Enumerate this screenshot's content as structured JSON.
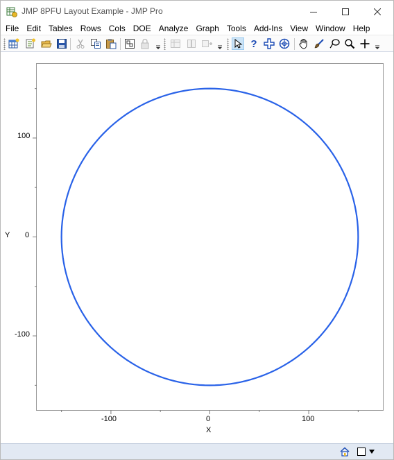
{
  "window": {
    "title": "JMP 8PFU Layout Example - JMP Pro"
  },
  "menu": {
    "items": [
      {
        "label": "File"
      },
      {
        "label": "Edit"
      },
      {
        "label": "Tables"
      },
      {
        "label": "Rows"
      },
      {
        "label": "Cols"
      },
      {
        "label": "DOE"
      },
      {
        "label": "Analyze"
      },
      {
        "label": "Graph"
      },
      {
        "label": "Tools"
      },
      {
        "label": "Add-Ins"
      },
      {
        "label": "View"
      },
      {
        "label": "Window"
      },
      {
        "label": "Help"
      }
    ]
  },
  "toolbar": {
    "icons": [
      "new-data-table-icon",
      "new-script-icon",
      "open-icon",
      "save-icon",
      "cut-icon",
      "copy-icon",
      "paste-icon",
      "report-icon",
      "lock-icon",
      "table-icon",
      "journal-icon",
      "add-icon",
      "arrow-icon",
      "help-icon",
      "crosshair-icon",
      "scroller-icon",
      "grabber-icon",
      "brush-icon",
      "lasso-icon",
      "magnifier-icon",
      "plus-icon"
    ]
  },
  "graph": {
    "x_axis": {
      "title": "X",
      "ticks": [
        "-100",
        "0",
        "100"
      ]
    },
    "y_axis": {
      "title": "Y",
      "ticks": [
        "100",
        "0",
        "-100"
      ]
    },
    "circle_color": "#2962e8"
  },
  "chart_data": {
    "type": "line",
    "series": [
      {
        "shape": "circle",
        "center": [
          0,
          0
        ],
        "radius": 150
      }
    ],
    "xlim": [
      -175,
      175
    ],
    "ylim": [
      -175,
      175
    ],
    "x_ticks": [
      -100,
      0,
      100
    ],
    "y_ticks": [
      -100,
      0,
      100
    ],
    "xlabel": "X",
    "ylabel": "Y",
    "grid": false
  }
}
